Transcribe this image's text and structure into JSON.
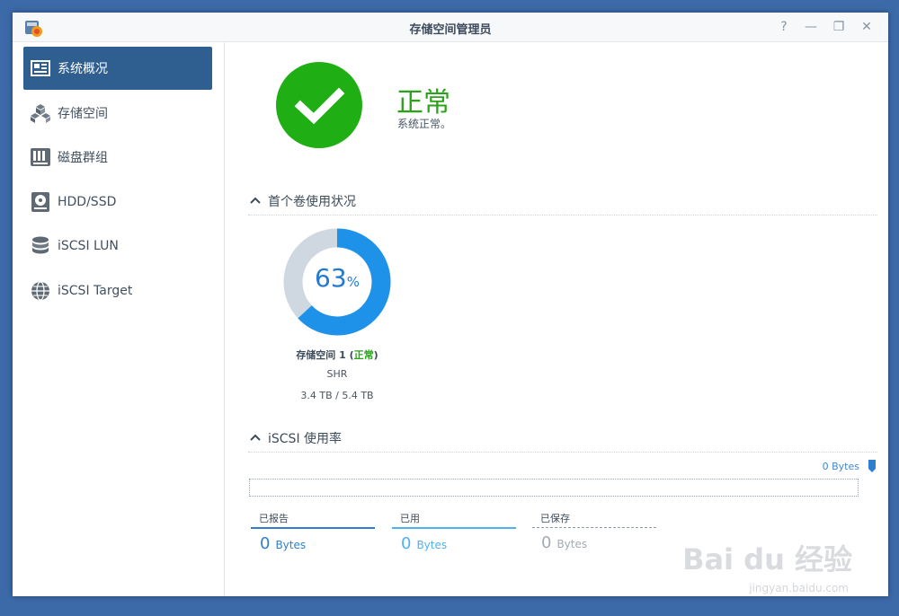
{
  "window": {
    "title": "存储空间管理员",
    "controls": [
      "?",
      "—",
      "❐",
      "✕"
    ]
  },
  "sidebar": {
    "items": [
      {
        "label": "系统概况",
        "icon": "overview-icon",
        "active": true
      },
      {
        "label": "存储空间",
        "icon": "cubes-icon",
        "active": false
      },
      {
        "label": "磁盘群组",
        "icon": "disk-group-icon",
        "active": false
      },
      {
        "label": "HDD/SSD",
        "icon": "hdd-icon",
        "active": false
      },
      {
        "label": "iSCSI LUN",
        "icon": "database-icon",
        "active": false
      },
      {
        "label": "iSCSI Target",
        "icon": "globe-icon",
        "active": false
      }
    ]
  },
  "status": {
    "title": "正常",
    "subtitle": "系统正常。",
    "color": "#1fae14"
  },
  "volume_section": {
    "heading": "首个卷使用状况",
    "percent": "63",
    "percent_sign": "%",
    "usage_fraction": 0.63,
    "volume_name": "存储空间 1 (",
    "volume_status": "正常",
    "volume_close": ")",
    "raid_type": "SHR",
    "size": "3.4 TB / 5.4 TB"
  },
  "iscsi_section": {
    "heading": "iSCSI 使用率",
    "top_value": "0 Bytes",
    "legend": [
      {
        "label": "已报告",
        "value": "0",
        "unit": "Bytes",
        "color": "#2f7fd1",
        "line": "solid"
      },
      {
        "label": "已用",
        "value": "0",
        "unit": "Bytes",
        "color": "#4fb1ef",
        "line": "solid"
      },
      {
        "label": "已保存",
        "value": "0",
        "unit": "Bytes",
        "color": "#a2abb5",
        "line": "dashed"
      }
    ]
  },
  "watermark": {
    "text": "Bai du 经验",
    "sub": "jingyan.baidu.com"
  }
}
